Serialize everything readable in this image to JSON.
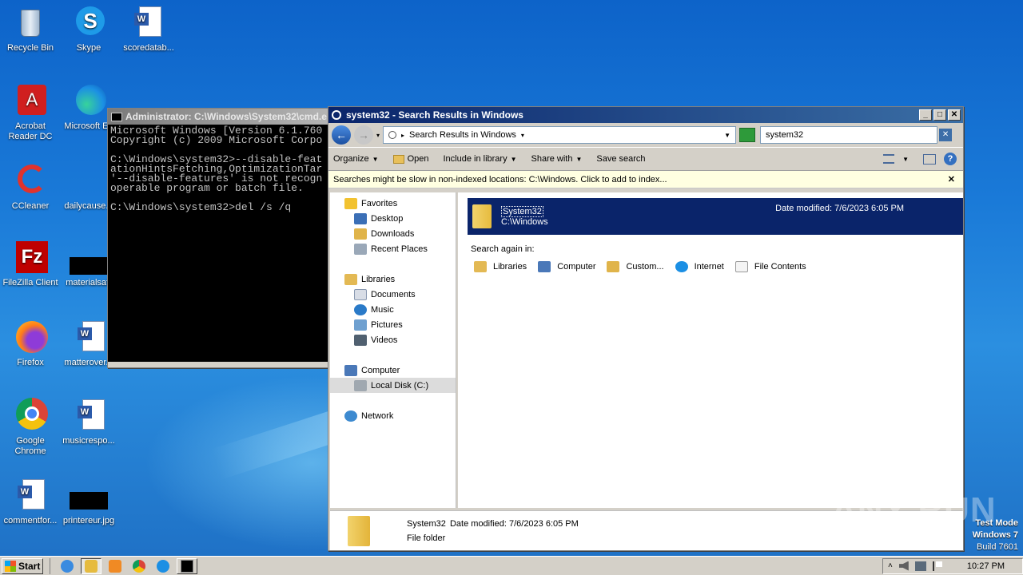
{
  "desktop_icons": [
    {
      "label": "Recycle Bin",
      "icon": "recycle-bin-icon"
    },
    {
      "label": "Skype",
      "icon": "skype-icon"
    },
    {
      "label": "scoredatab...",
      "icon": "word-doc-icon"
    },
    {
      "label": "Acrobat Reader DC",
      "icon": "acrobat-icon"
    },
    {
      "label": "Microsoft Ed",
      "icon": "edge-icon"
    },
    {
      "label": "CCleaner",
      "icon": "ccleaner-icon"
    },
    {
      "label": "dailycause...",
      "icon": "file-icon"
    },
    {
      "label": "FileZilla Client",
      "icon": "filezilla-icon"
    },
    {
      "label": "materialsafr",
      "icon": "image-file-icon"
    },
    {
      "label": "Firefox",
      "icon": "firefox-icon"
    },
    {
      "label": "matterover...",
      "icon": "word-doc-icon"
    },
    {
      "label": "Google Chrome",
      "icon": "chrome-icon"
    },
    {
      "label": "musicrespo...",
      "icon": "word-doc-icon"
    },
    {
      "label": "commentfor...",
      "icon": "word-doc-icon"
    },
    {
      "label": "printereur.jpg",
      "icon": "image-file-icon"
    }
  ],
  "cmd": {
    "title": "Administrator: C:\\Windows\\System32\\cmd.e",
    "lines": "Microsoft Windows [Version 6.1.760\nCopyright (c) 2009 Microsoft Corpo\n\nC:\\Windows\\system32>--disable-feat\nationHintsFetching,OptimizationTar\n'--disable-features' is not recogn\noperable program or batch file.\n\nC:\\Windows\\system32>del /s /q"
  },
  "explorer": {
    "title": "system32 - Search Results in Windows",
    "breadcrumb": "Search Results in Windows",
    "search_value": "system32",
    "toolbar": {
      "organize": "Organize",
      "open": "Open",
      "include": "Include in library",
      "share": "Share with",
      "save": "Save search"
    },
    "infobar": "Searches might be slow in non-indexed locations: C:\\Windows. Click to add to index...",
    "nav": {
      "favorites": "Favorites",
      "desktop": "Desktop",
      "downloads": "Downloads",
      "recent": "Recent Places",
      "libraries": "Libraries",
      "documents": "Documents",
      "music": "Music",
      "pictures": "Pictures",
      "videos": "Videos",
      "computer": "Computer",
      "localdisk": "Local Disk (C:)",
      "network": "Network"
    },
    "result": {
      "name": "System32",
      "path": "C:\\Windows",
      "date": "Date modified: 7/6/2023 6:05 PM"
    },
    "search_again": {
      "label": "Search again in:",
      "items": [
        "Libraries",
        "Computer",
        "Custom...",
        "Internet",
        "File Contents"
      ]
    },
    "details": {
      "name": "System32",
      "date": "Date modified: 7/6/2023 6:05 PM",
      "type": "File folder"
    }
  },
  "watermark": {
    "brand": "ANY RUN",
    "mode": "Test Mode",
    "os": "Windows 7",
    "build": "Build 7601"
  },
  "taskbar": {
    "start": "Start",
    "time": "10:27 PM"
  }
}
